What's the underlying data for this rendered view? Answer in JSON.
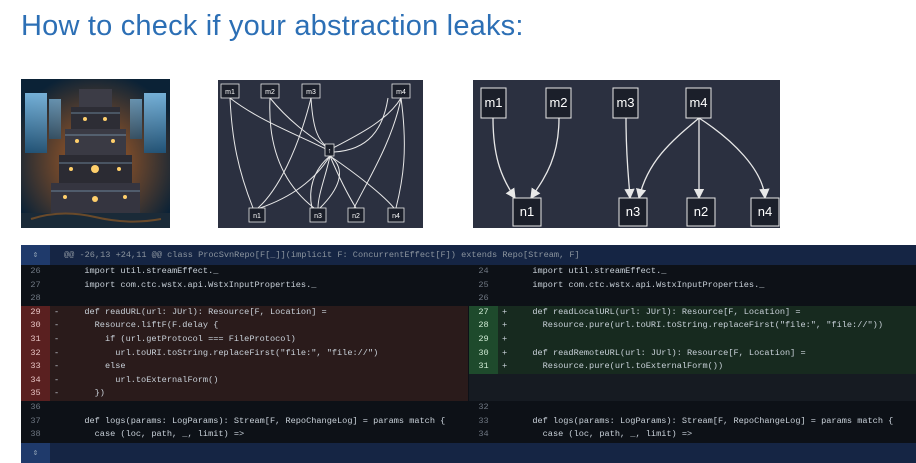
{
  "slide": {
    "title": "How to check if your abstraction leaks:"
  },
  "graph_small": {
    "top_nodes": [
      "m1",
      "m2",
      "m3",
      "m4"
    ],
    "bottom_nodes": [
      "n1",
      "n3",
      "n2",
      "n4"
    ],
    "hub_label": "↑"
  },
  "graph_large": {
    "top_nodes": [
      "m1",
      "m2",
      "m3",
      "m4"
    ],
    "bottom_nodes": [
      "n1",
      "n3",
      "n2",
      "n4"
    ]
  },
  "diff": {
    "hunk_header": "@@ -26,13 +24,11 @@ class ProcSvnRepo[F[_]](implicit F: ConcurrentEffect[F]) extends Repo[Stream, F]",
    "left": [
      {
        "num": "26",
        "sign": "",
        "code": "  import util.streamEffect._",
        "kind": "ctx"
      },
      {
        "num": "27",
        "sign": "",
        "code": "  import com.ctc.wstx.api.WstxInputProperties._",
        "kind": "ctx"
      },
      {
        "num": "28",
        "sign": "",
        "code": "",
        "kind": "ctx"
      },
      {
        "num": "29",
        "sign": "-",
        "code": "  def readURL(url: JUrl): Resource[F, Location] =",
        "kind": "del"
      },
      {
        "num": "30",
        "sign": "-",
        "code": "    Resource.liftF(F.delay {",
        "kind": "del"
      },
      {
        "num": "31",
        "sign": "-",
        "code": "      if (url.getProtocol === FileProtocol)",
        "kind": "del"
      },
      {
        "num": "32",
        "sign": "-",
        "code": "        url.toURI.toString.replaceFirst(\"file:\", \"file://\")",
        "kind": "del"
      },
      {
        "num": "33",
        "sign": "-",
        "code": "      else",
        "kind": "del"
      },
      {
        "num": "34",
        "sign": "-",
        "code": "        url.toExternalForm()",
        "kind": "del"
      },
      {
        "num": "35",
        "sign": "-",
        "code": "    })",
        "kind": "del"
      },
      {
        "num": "36",
        "sign": "",
        "code": "",
        "kind": "ctx"
      },
      {
        "num": "37",
        "sign": "",
        "code": "  def logs(params: LogParams): Stream[F, RepoChangeLog] = params match {",
        "kind": "ctx"
      },
      {
        "num": "38",
        "sign": "",
        "code": "    case (loc, path, _, limit) =>",
        "kind": "ctx"
      }
    ],
    "right": [
      {
        "num": "24",
        "sign": "",
        "code": "  import util.streamEffect._",
        "kind": "ctx"
      },
      {
        "num": "25",
        "sign": "",
        "code": "  import com.ctc.wstx.api.WstxInputProperties._",
        "kind": "ctx"
      },
      {
        "num": "26",
        "sign": "",
        "code": "",
        "kind": "ctx"
      },
      {
        "num": "27",
        "sign": "+",
        "code": "  def readLocalURL(url: JUrl): Resource[F, Location] =",
        "kind": "add"
      },
      {
        "num": "28",
        "sign": "+",
        "code": "    Resource.pure(url.toURI.toString.replaceFirst(\"file:\", \"file://\"))",
        "kind": "add"
      },
      {
        "num": "29",
        "sign": "+",
        "code": "",
        "kind": "add"
      },
      {
        "num": "30",
        "sign": "+",
        "code": "  def readRemoteURL(url: JUrl): Resource[F, Location] =",
        "kind": "add"
      },
      {
        "num": "31",
        "sign": "+",
        "code": "    Resource.pure(url.toExternalForm())",
        "kind": "add"
      },
      {
        "num": "",
        "sign": "",
        "code": "",
        "kind": "empty"
      },
      {
        "num": "",
        "sign": "",
        "code": "",
        "kind": "empty"
      },
      {
        "num": "32",
        "sign": "",
        "code": "",
        "kind": "ctx"
      },
      {
        "num": "33",
        "sign": "",
        "code": "  def logs(params: LogParams): Stream[F, RepoChangeLog] = params match {",
        "kind": "ctx"
      },
      {
        "num": "34",
        "sign": "",
        "code": "    case (loc, path, _, limit) =>",
        "kind": "ctx"
      }
    ],
    "expand_icon": "expand-icon"
  }
}
